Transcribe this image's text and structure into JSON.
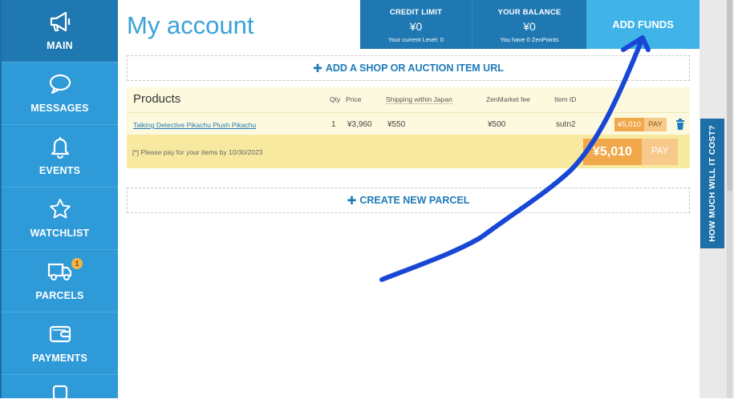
{
  "sidebar": {
    "items": [
      {
        "label": "MAIN",
        "icon": "megaphone-icon",
        "active": true
      },
      {
        "label": "MESSAGES",
        "icon": "chat-bubble-icon"
      },
      {
        "label": "EVENTS",
        "icon": "bell-icon"
      },
      {
        "label": "WATCHLIST",
        "icon": "star-icon"
      },
      {
        "label": "PARCELS",
        "icon": "truck-icon",
        "badge": "1"
      },
      {
        "label": "PAYMENTS",
        "icon": "wallet-icon"
      }
    ]
  },
  "header": {
    "title": "My account",
    "credit_limit": {
      "title": "CREDIT LIMIT",
      "value": "¥0",
      "sub": "Your current Level: 0"
    },
    "balance": {
      "title": "YOUR BALANCE",
      "value": "¥0",
      "sub": "You have 0 ZenPoints"
    },
    "add_funds": "ADD FUNDS"
  },
  "actions": {
    "add_item": "ADD A SHOP OR AUCTION ITEM URL",
    "create_parcel": "CREATE NEW PARCEL"
  },
  "products": {
    "title": "Products",
    "columns": {
      "qty": "Qty",
      "price": "Price",
      "shipping": "Shipping within Japan",
      "fee": "ZenMarket fee",
      "item_id": "Item ID"
    },
    "rows": [
      {
        "name": "Talking Detective Pikachu Plush Pikachu",
        "qty": "1",
        "price": "¥3,960",
        "shipping": "¥550",
        "fee": "¥500",
        "item_id": "sutn2",
        "total": "¥5,010",
        "pay_label": "PAY"
      }
    ],
    "note": "[*] Please pay for your items by 10/30/2023",
    "total": "¥5,010",
    "pay_label": "PAY"
  },
  "side_tab": "HOW MUCH WILL IT COST?",
  "colors": {
    "sidebar": "#2f9ad8",
    "accent": "#1f78b1",
    "add_funds": "#40b4e8",
    "pay": "#f0a84a",
    "arrow": "#1847d6"
  }
}
